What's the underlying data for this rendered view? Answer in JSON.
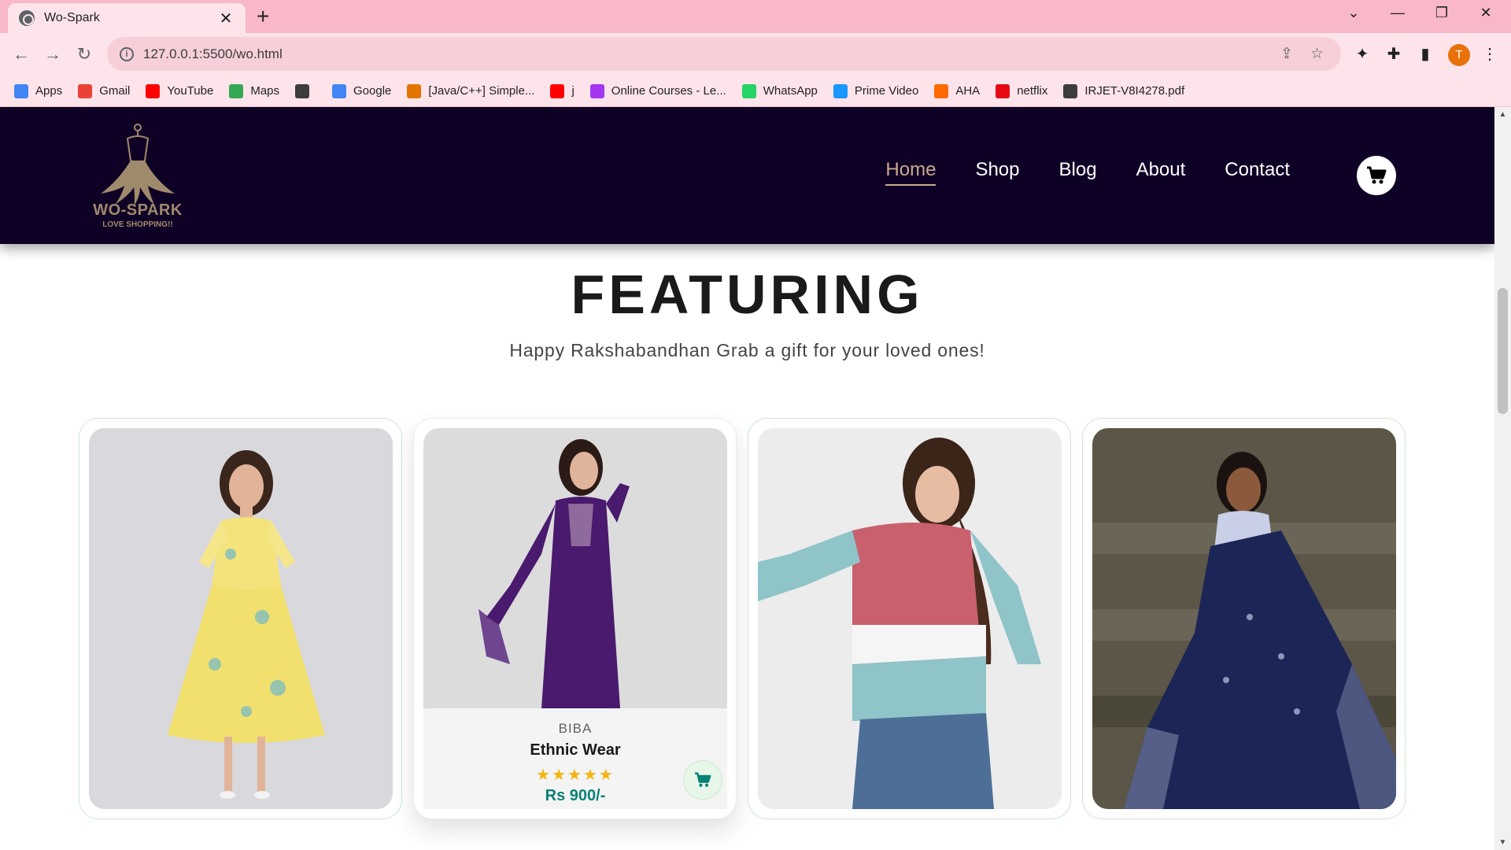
{
  "browser": {
    "tab_title": "Wo-Spark",
    "url": "127.0.0.1:5500/wo.html",
    "profile_initial": "T",
    "bookmarks": [
      {
        "label": "Apps",
        "icon": "apps-grid-icon",
        "color": "#4285f4"
      },
      {
        "label": "Gmail",
        "icon": "gmail-icon",
        "color": "#ea4335"
      },
      {
        "label": "YouTube",
        "icon": "youtube-icon",
        "color": "#ff0000"
      },
      {
        "label": "Maps",
        "icon": "maps-pin-icon",
        "color": "#34a853"
      },
      {
        "label": "",
        "icon": "globe-icon",
        "color": "#3c3c3c"
      },
      {
        "label": "Google",
        "icon": "google-icon",
        "color": "#4285f4"
      },
      {
        "label": "[Java/C++] Simple...",
        "icon": "code-icon",
        "color": "#e37400"
      },
      {
        "label": "j",
        "icon": "youtube-icon",
        "color": "#ff0000"
      },
      {
        "label": "Online Courses - Le...",
        "icon": "udemy-icon",
        "color": "#a435f0"
      },
      {
        "label": "WhatsApp",
        "icon": "whatsapp-icon",
        "color": "#25d366"
      },
      {
        "label": "Prime Video",
        "icon": "prime-video-icon",
        "color": "#1a98ff"
      },
      {
        "label": "AHA",
        "icon": "aha-icon",
        "color": "#ff6a00"
      },
      {
        "label": "netflix",
        "icon": "netflix-icon",
        "color": "#e50914"
      },
      {
        "label": "IRJET-V8I4278.pdf",
        "icon": "globe-icon",
        "color": "#3c3c3c"
      }
    ]
  },
  "site": {
    "logo_text": "WO-SPARK",
    "logo_sub": "LOVE SHOPPING!!",
    "nav": [
      "Home",
      "Shop",
      "Blog",
      "About",
      "Contact"
    ],
    "active_nav": "Home",
    "header_bg": "#0f0126"
  },
  "section": {
    "title": "FEATURING",
    "subtitle": "Happy Rakshabandhan Grab a gift for your loved ones!"
  },
  "product": {
    "brand": "BIBA",
    "name": "Ethnic Wear",
    "stars": "★★★★★",
    "price": "Rs 900/-"
  }
}
